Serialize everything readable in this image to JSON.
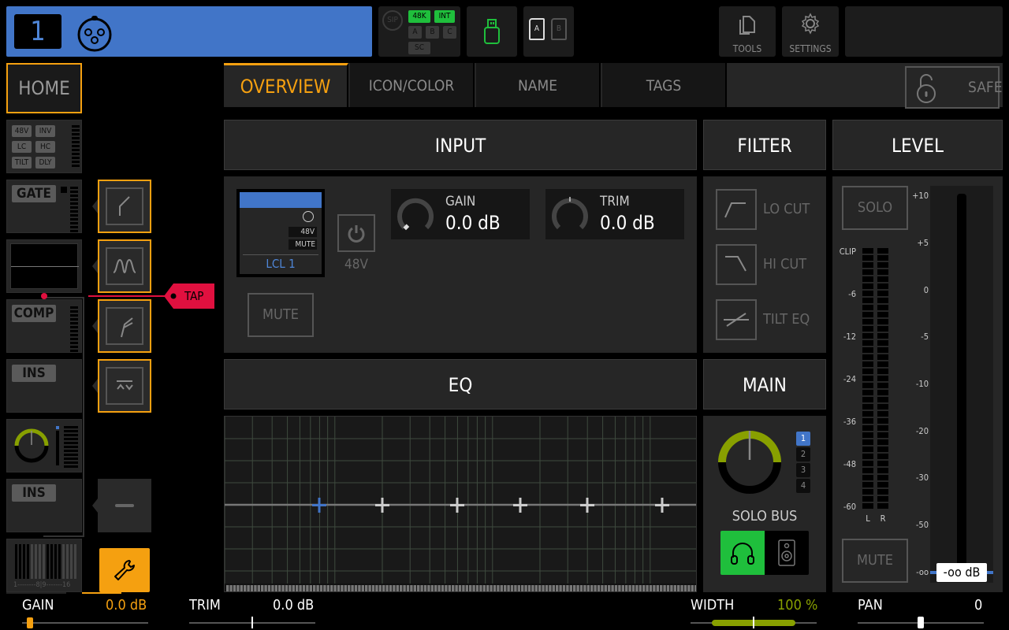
{
  "header": {
    "channel_number": "1",
    "channel_color": "#4175c8",
    "input_icon": "xlr-connector-icon",
    "status": {
      "sip_label": "SIP",
      "sample_rate": "48K",
      "clock": "INT",
      "buses": [
        "A",
        "B",
        "C"
      ],
      "sc_label": "SC"
    },
    "usb_icon": "usb-drive-icon",
    "cards": [
      "A",
      "B"
    ],
    "tools_label": "TOOLS",
    "settings_label": "SETTINGS"
  },
  "sidebar": {
    "home_label": "HOME",
    "input_tags": [
      "48V",
      "INV",
      "LC",
      "HC",
      "TILT",
      "DLY"
    ],
    "gate_label": "GATE",
    "comp_label": "COMP",
    "ins1_label": "INS",
    "ins2_label": "INS",
    "tap_label": "TAP",
    "bus_scale": "1--------8|9-------16",
    "fx_slots": [
      "gate-curve-icon",
      "eq-curve-icon",
      "comp-curve-icon",
      "insert-icon"
    ]
  },
  "tabs": [
    {
      "label": "OVERVIEW",
      "active": true
    },
    {
      "label": "ICON/COLOR",
      "active": false
    },
    {
      "label": "NAME",
      "active": false
    },
    {
      "label": "TAGS",
      "active": false
    }
  ],
  "safe_label": "SAFE",
  "input": {
    "title": "INPUT",
    "source_name": "LCL 1",
    "source_tags": [
      "48V",
      "MUTE"
    ],
    "phantom_label": "48V",
    "mute_label": "MUTE",
    "gain_label": "GAIN",
    "gain_value": "0.0 dB",
    "trim_label": "TRIM",
    "trim_value": "0.0 dB"
  },
  "filter": {
    "title": "FILTER",
    "items": [
      "LO CUT",
      "HI CUT",
      "TILT EQ"
    ]
  },
  "eq": {
    "title": "EQ",
    "band_count": 6,
    "selected_band": 1
  },
  "main": {
    "title": "MAIN",
    "solo_bus_label": "SOLO BUS",
    "bus_numbers": [
      "1",
      "2",
      "3",
      "4"
    ],
    "selected_bus": "1",
    "accent": "#88a000"
  },
  "level": {
    "title": "LEVEL",
    "solo_label": "SOLO",
    "mute_label": "MUTE",
    "meter_scale": [
      "CLIP",
      "-6",
      "-12",
      "-24",
      "-36",
      "-48",
      "-60"
    ],
    "meter_channels": [
      "L",
      "R"
    ],
    "fader_scale": [
      "+10",
      "+5",
      "0",
      "-5",
      "-10",
      "-20",
      "-30",
      "-50",
      "-oo"
    ],
    "fader_value": "-oo dB"
  },
  "bottom": {
    "gain_label": "GAIN",
    "gain_value": "0.0 dB",
    "trim_label": "TRIM",
    "trim_value": "0.0 dB",
    "width_label": "WIDTH",
    "width_value": "100 %",
    "pan_label": "PAN",
    "pan_value": "0"
  },
  "colors": {
    "accent_orange": "#f5a010",
    "active_green": "#1fbf3c",
    "width_green": "#88a000",
    "tap_red": "#e0103f",
    "blue": "#4175c8"
  }
}
